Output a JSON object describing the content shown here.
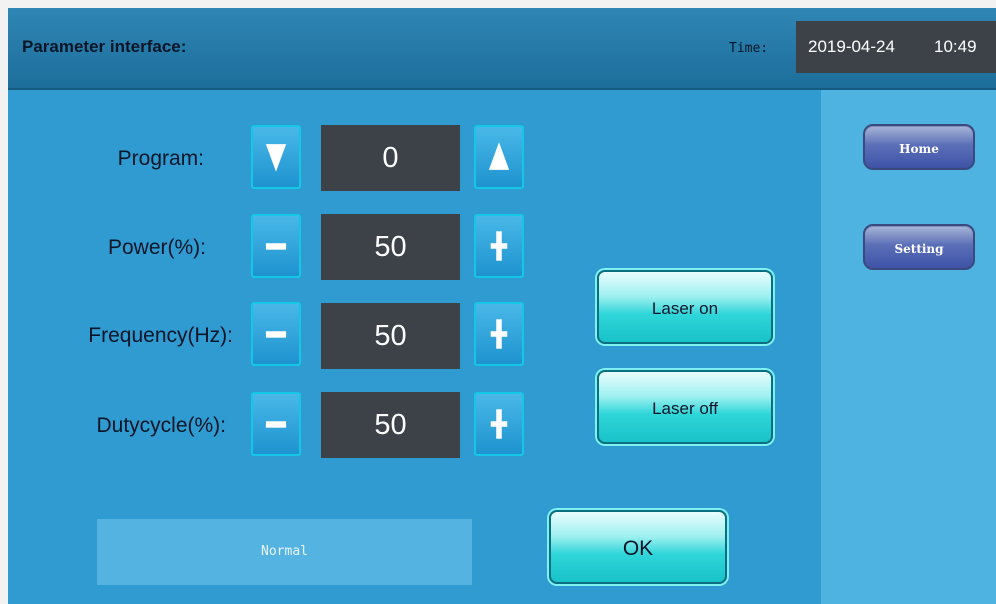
{
  "header": {
    "title": "Parameter interface:",
    "time_label": "Time:",
    "date": "2019-04-24",
    "clock": "10:49"
  },
  "params": [
    {
      "label": "Program:",
      "value": "0",
      "dec_icon": "down-triangle-icon",
      "inc_icon": "up-triangle-icon"
    },
    {
      "label": "Power(%):",
      "value": "50",
      "dec_icon": "minus-icon",
      "inc_icon": "plus-icon"
    },
    {
      "label": "Frequency(Hz):",
      "value": "50",
      "dec_icon": "minus-icon",
      "inc_icon": "plus-icon"
    },
    {
      "label": "Dutycycle(%):",
      "value": "50",
      "dec_icon": "minus-icon",
      "inc_icon": "plus-icon"
    }
  ],
  "actions": {
    "laser_on": "Laser on",
    "laser_off": "Laser off",
    "ok": "OK"
  },
  "status": "Normal",
  "nav": {
    "home": "Home",
    "setting": "Setting"
  },
  "colors": {
    "background": "#2f9bd1",
    "header": "#1d6e9b",
    "value_box": "#3c4248",
    "action_button": "#2fd6d9",
    "nav_button": "#3e53a6"
  }
}
